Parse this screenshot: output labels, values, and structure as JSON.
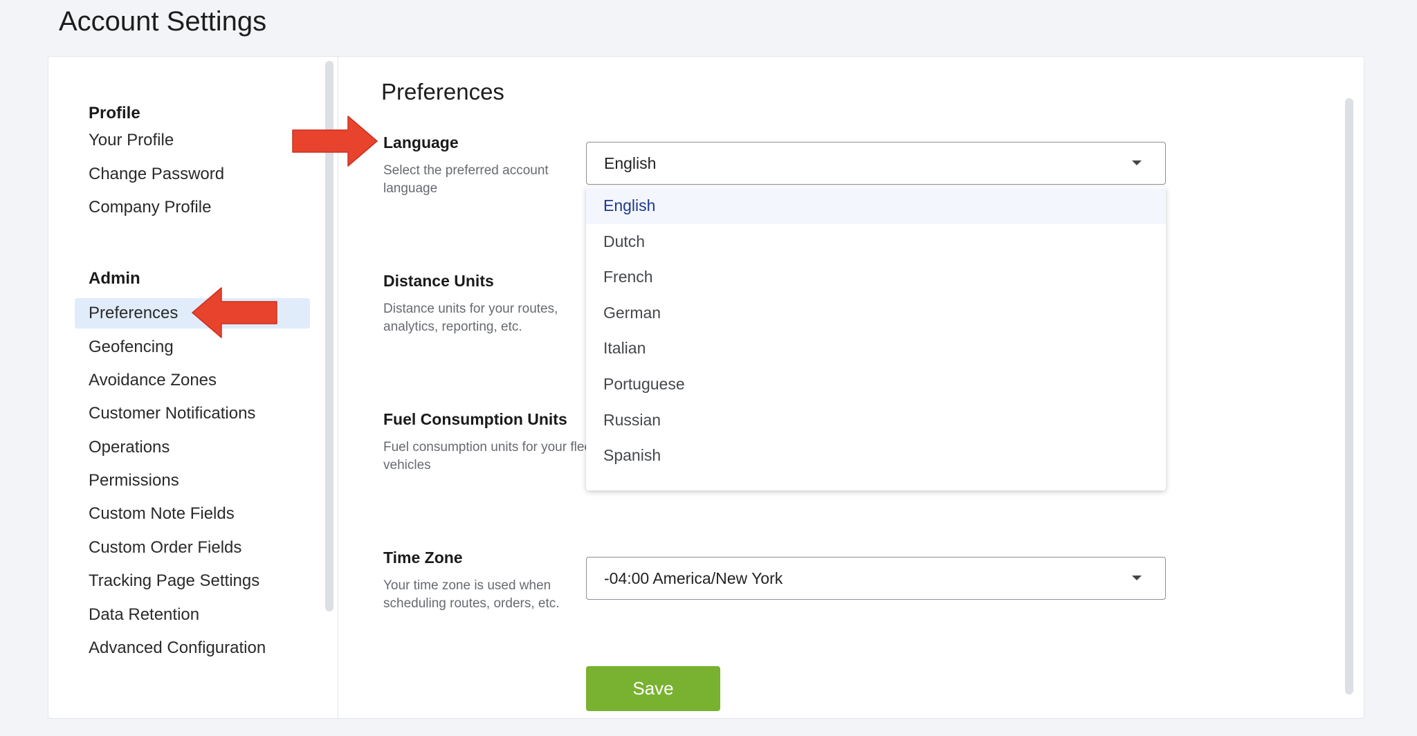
{
  "page_title": "Account Settings",
  "sidebar": {
    "profile_section": "Profile",
    "profile_items": [
      "Your Profile",
      "Change Password",
      "Company Profile"
    ],
    "admin_section": "Admin",
    "admin_items": [
      "Preferences",
      "Geofencing",
      "Avoidance Zones",
      "Customer Notifications",
      "Operations",
      "Permissions",
      "Custom Note Fields",
      "Custom Order Fields",
      "Tracking Page Settings",
      "Data Retention",
      "Advanced Configuration"
    ],
    "active_item": "Preferences"
  },
  "content": {
    "title": "Preferences",
    "language": {
      "label": "Language",
      "description": "Select the preferred account language",
      "value": "English",
      "options": [
        "English",
        "Dutch",
        "French",
        "German",
        "Italian",
        "Portuguese",
        "Russian",
        "Spanish"
      ]
    },
    "distance_units": {
      "label": "Distance Units",
      "description": "Distance units for your routes, analytics, reporting, etc."
    },
    "fuel_units": {
      "label": "Fuel Consumption Units",
      "description": "Fuel consumption units for your fleet vehicles"
    },
    "time_zone": {
      "label": "Time Zone",
      "description": "Your time zone is used when scheduling routes, orders, etc.",
      "value": "-04:00 America/New York"
    },
    "save_label": "Save"
  },
  "colors": {
    "accent_green": "#79b131",
    "active_nav_bg": "#e1ecfb",
    "annotation_arrow": "#e8432d",
    "selected_option_text": "#1f3a8a"
  },
  "icons": {
    "dropdown_caret": "caret-down-icon",
    "annotation": "arrow-annotation-icon"
  }
}
